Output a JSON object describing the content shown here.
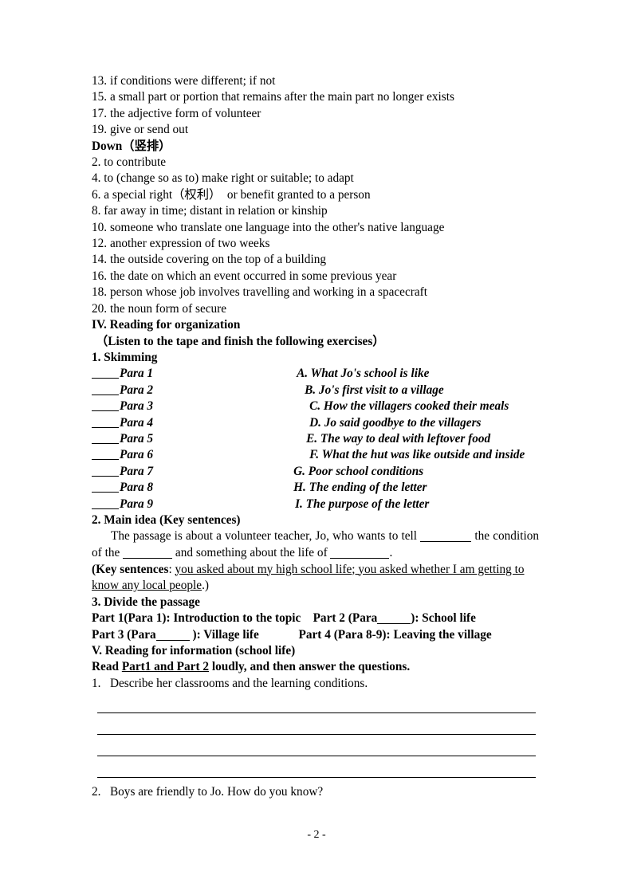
{
  "document": {
    "page_number": "- 2 -",
    "across_remaining_clues": [
      "13. if conditions were different; if not",
      "15. a small part or portion that remains after the main part no longer exists",
      "17. the adjective form of volunteer",
      "19. give or send out"
    ],
    "down_heading": "Down（竖排）",
    "down_clues": [
      "2. to contribute",
      "4. to (change so as to) make right or suitable; to adapt",
      "6. a special right（权利）  or benefit granted to a person",
      "8. far away in time; distant in relation or kinship",
      "10. someone who translate one language into the other's native language",
      "12. another expression of two weeks",
      "14. the outside covering on the top of a building",
      "16. the date on which an event occurred in some previous year",
      "18. person whose job involves travelling and working in a spacecraft",
      "20. the noun form of secure"
    ],
    "section_iv": {
      "heading": "IV. Reading for organization",
      "subheading": "（Listen to the tape and finish the following exercises）",
      "task1_heading": "1. Skimming",
      "matching": [
        {
          "para": "Para 1",
          "option": "A. What Jo's school is like",
          "indent": 180
        },
        {
          "para": "Para 2",
          "option": "B. Jo's first visit to a village",
          "indent": 190
        },
        {
          "para": "Para 3",
          "option": "C. How the villagers cooked their meals",
          "indent": 196
        },
        {
          "para": "Para 4",
          "option": "D. Jo said goodbye to the villagers",
          "indent": 196
        },
        {
          "para": "Para 5",
          "option": "E. The way to deal with leftover food",
          "indent": 192
        },
        {
          "para": "Para 6",
          "option": "F. What the hut was like outside and inside",
          "indent": 196
        },
        {
          "para": "Para 7",
          "option": "G. Poor school conditions",
          "indent": 176
        },
        {
          "para": "Para 8",
          "option": "H. The ending of the letter",
          "indent": 176
        },
        {
          "para": "Para 9",
          "option": "I. The purpose of the letter",
          "indent": 178
        }
      ],
      "task2_heading": "2. Main idea (Key sentences)",
      "main_idea": {
        "part1": "The passage is about a volunteer teacher, Jo, who wants to tell ",
        "part2": " the condition of the ",
        "part3": " and something about the life of ",
        "part4": "."
      },
      "key_sentences": {
        "label": "(Key sentences",
        "colon": ": ",
        "sentence1": "you asked about my high school life",
        "separator": "; ",
        "sentence2": "you asked whether I am getting to know any local people",
        "close": ".)"
      },
      "task3_heading": "3. Divide the passage",
      "parts": {
        "part1_pre": "Part 1(Para 1): Introduction to the topic",
        "part2_pre": "Part 2 (Para",
        "part2_post": "): School life",
        "part3_pre": "Part 3 (Para",
        "part3_post": " ): Village life",
        "part4": "Part 4 (Para 8-9): Leaving the village"
      }
    },
    "section_v": {
      "heading": "V. Reading for information (school life)",
      "instruction_pre": "Read ",
      "instruction_underlined": "Part1 and Part 2",
      "instruction_post": " loudly, and then answer the questions.",
      "questions": [
        "1.   Describe her classrooms and the learning conditions.",
        "2.   Boys are friendly to Jo. How do you know?"
      ],
      "answer_line_count": 4
    }
  }
}
